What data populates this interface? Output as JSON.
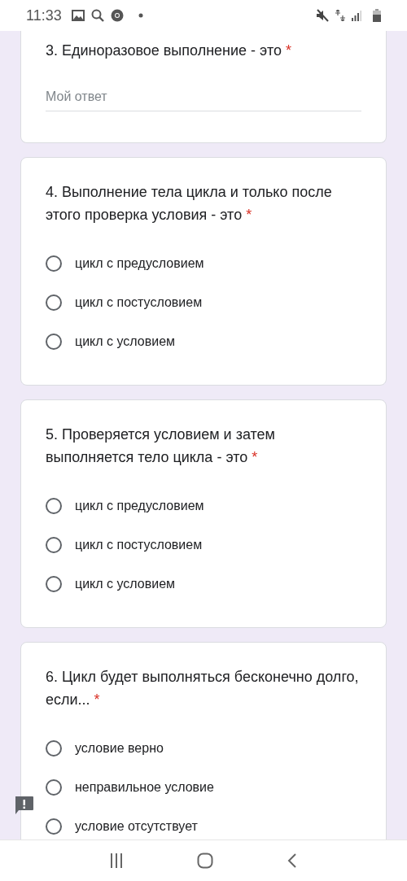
{
  "status_bar": {
    "time": "11:33"
  },
  "questions": [
    {
      "kind": "text",
      "title": "3. Единоразовое выполнение - это",
      "asterisk": "*",
      "placeholder": "Мой ответ"
    },
    {
      "kind": "choice",
      "title": "4. Выполнение тела цикла и только после этого проверка условия - это",
      "asterisk": "*",
      "options": [
        {
          "label": "цикл с предусловием",
          "selected": false
        },
        {
          "label": "цикл с постусловием",
          "selected": false
        },
        {
          "label": "цикл с условием",
          "selected": false
        }
      ]
    },
    {
      "kind": "choice",
      "title": "5. Проверяется условием и затем выполняется тело цикла - это",
      "asterisk": "*",
      "options": [
        {
          "label": "цикл с предусловием",
          "selected": false
        },
        {
          "label": "цикл с постусловием",
          "selected": false
        },
        {
          "label": "цикл с условием",
          "selected": false
        }
      ]
    },
    {
      "kind": "choice",
      "title": "6. Цикл будет выполняться бесконечно долго, если...",
      "asterisk": "*",
      "options": [
        {
          "label": "условие верно",
          "selected": false
        },
        {
          "label": "неправильное условие",
          "selected": false
        },
        {
          "label": "условие отсутствует",
          "selected": false
        }
      ]
    }
  ]
}
